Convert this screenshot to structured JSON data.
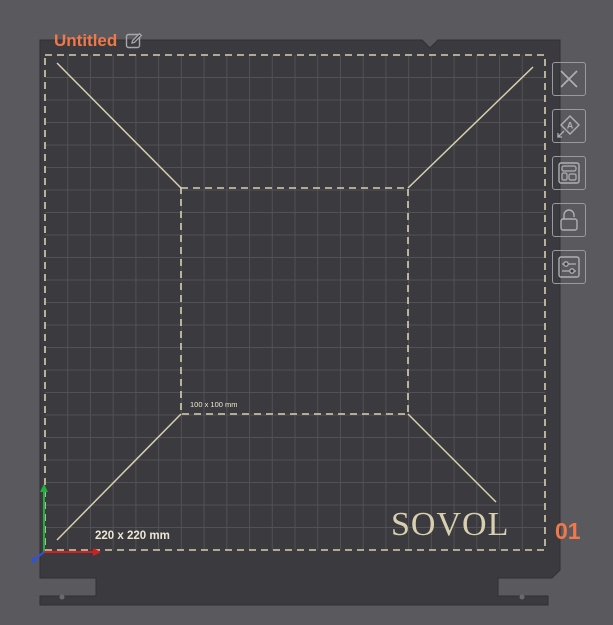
{
  "plate": {
    "title": "Untitled",
    "index": "01",
    "brand": "SOVOL",
    "bed_size_label": "220 x 220 mm",
    "inner_area_label": "100 x 100 mm"
  },
  "toolbar": {
    "items": [
      {
        "name": "remove-plate-button",
        "icon": "close-icon"
      },
      {
        "name": "auto-orient-button",
        "icon": "orient-icon"
      },
      {
        "name": "arrange-button",
        "icon": "arrange-icon"
      },
      {
        "name": "lock-button",
        "icon": "lock-icon"
      },
      {
        "name": "plate-settings-button",
        "icon": "sliders-icon"
      }
    ]
  },
  "colors": {
    "background": "#5a5a5e",
    "plate": "#3b3b3f",
    "grid": "#505055",
    "outline": "#d8cfb0",
    "accent": "#f0784a",
    "axis_x": "#d02020",
    "axis_y": "#20b040",
    "axis_z": "#3050e0"
  }
}
